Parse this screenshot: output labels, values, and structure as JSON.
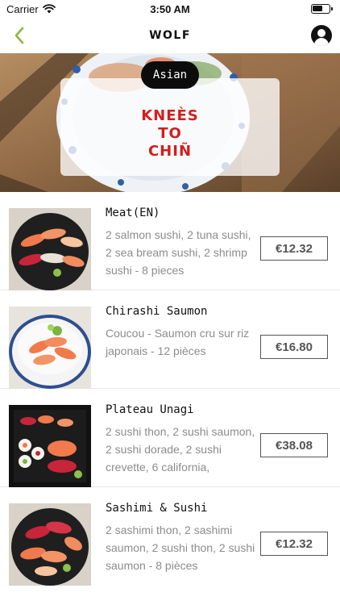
{
  "status_bar": {
    "carrier": "Carrier",
    "time": "3:50 AM"
  },
  "nav": {
    "logo": "WOLF"
  },
  "hero": {
    "category": "Asian",
    "title": "Kneès\nto\nChiñ"
  },
  "products": [
    {
      "name": "Meat(EN)",
      "description": "2 salmon sushi, 2 tuna sushi, 2 sea bream sushi, 2 shrimp sushi - 8 pieces",
      "price": "€12.32"
    },
    {
      "name": "Chirashi Saumon",
      "description": "Coucou - Saumon cru sur riz japonais - 12 pièces",
      "price": "€16.80"
    },
    {
      "name": "Plateau Unagi",
      "description": "2 sushi thon, 2 sushi saumon, 2 sushi dorade, 2 sushi crevette, 6 california,",
      "price": "€38.08"
    },
    {
      "name": "Sashimi & Sushi",
      "description": "2 sashimi thon, 2 sashimi saumon, 2 sushi thon, 2 sushi saumon - 8 pièces",
      "price": "€12.32"
    }
  ],
  "colors": {
    "accent_green": "#8db83a",
    "title_red": "#d41d1d",
    "pill_black": "#0c0c0c"
  }
}
